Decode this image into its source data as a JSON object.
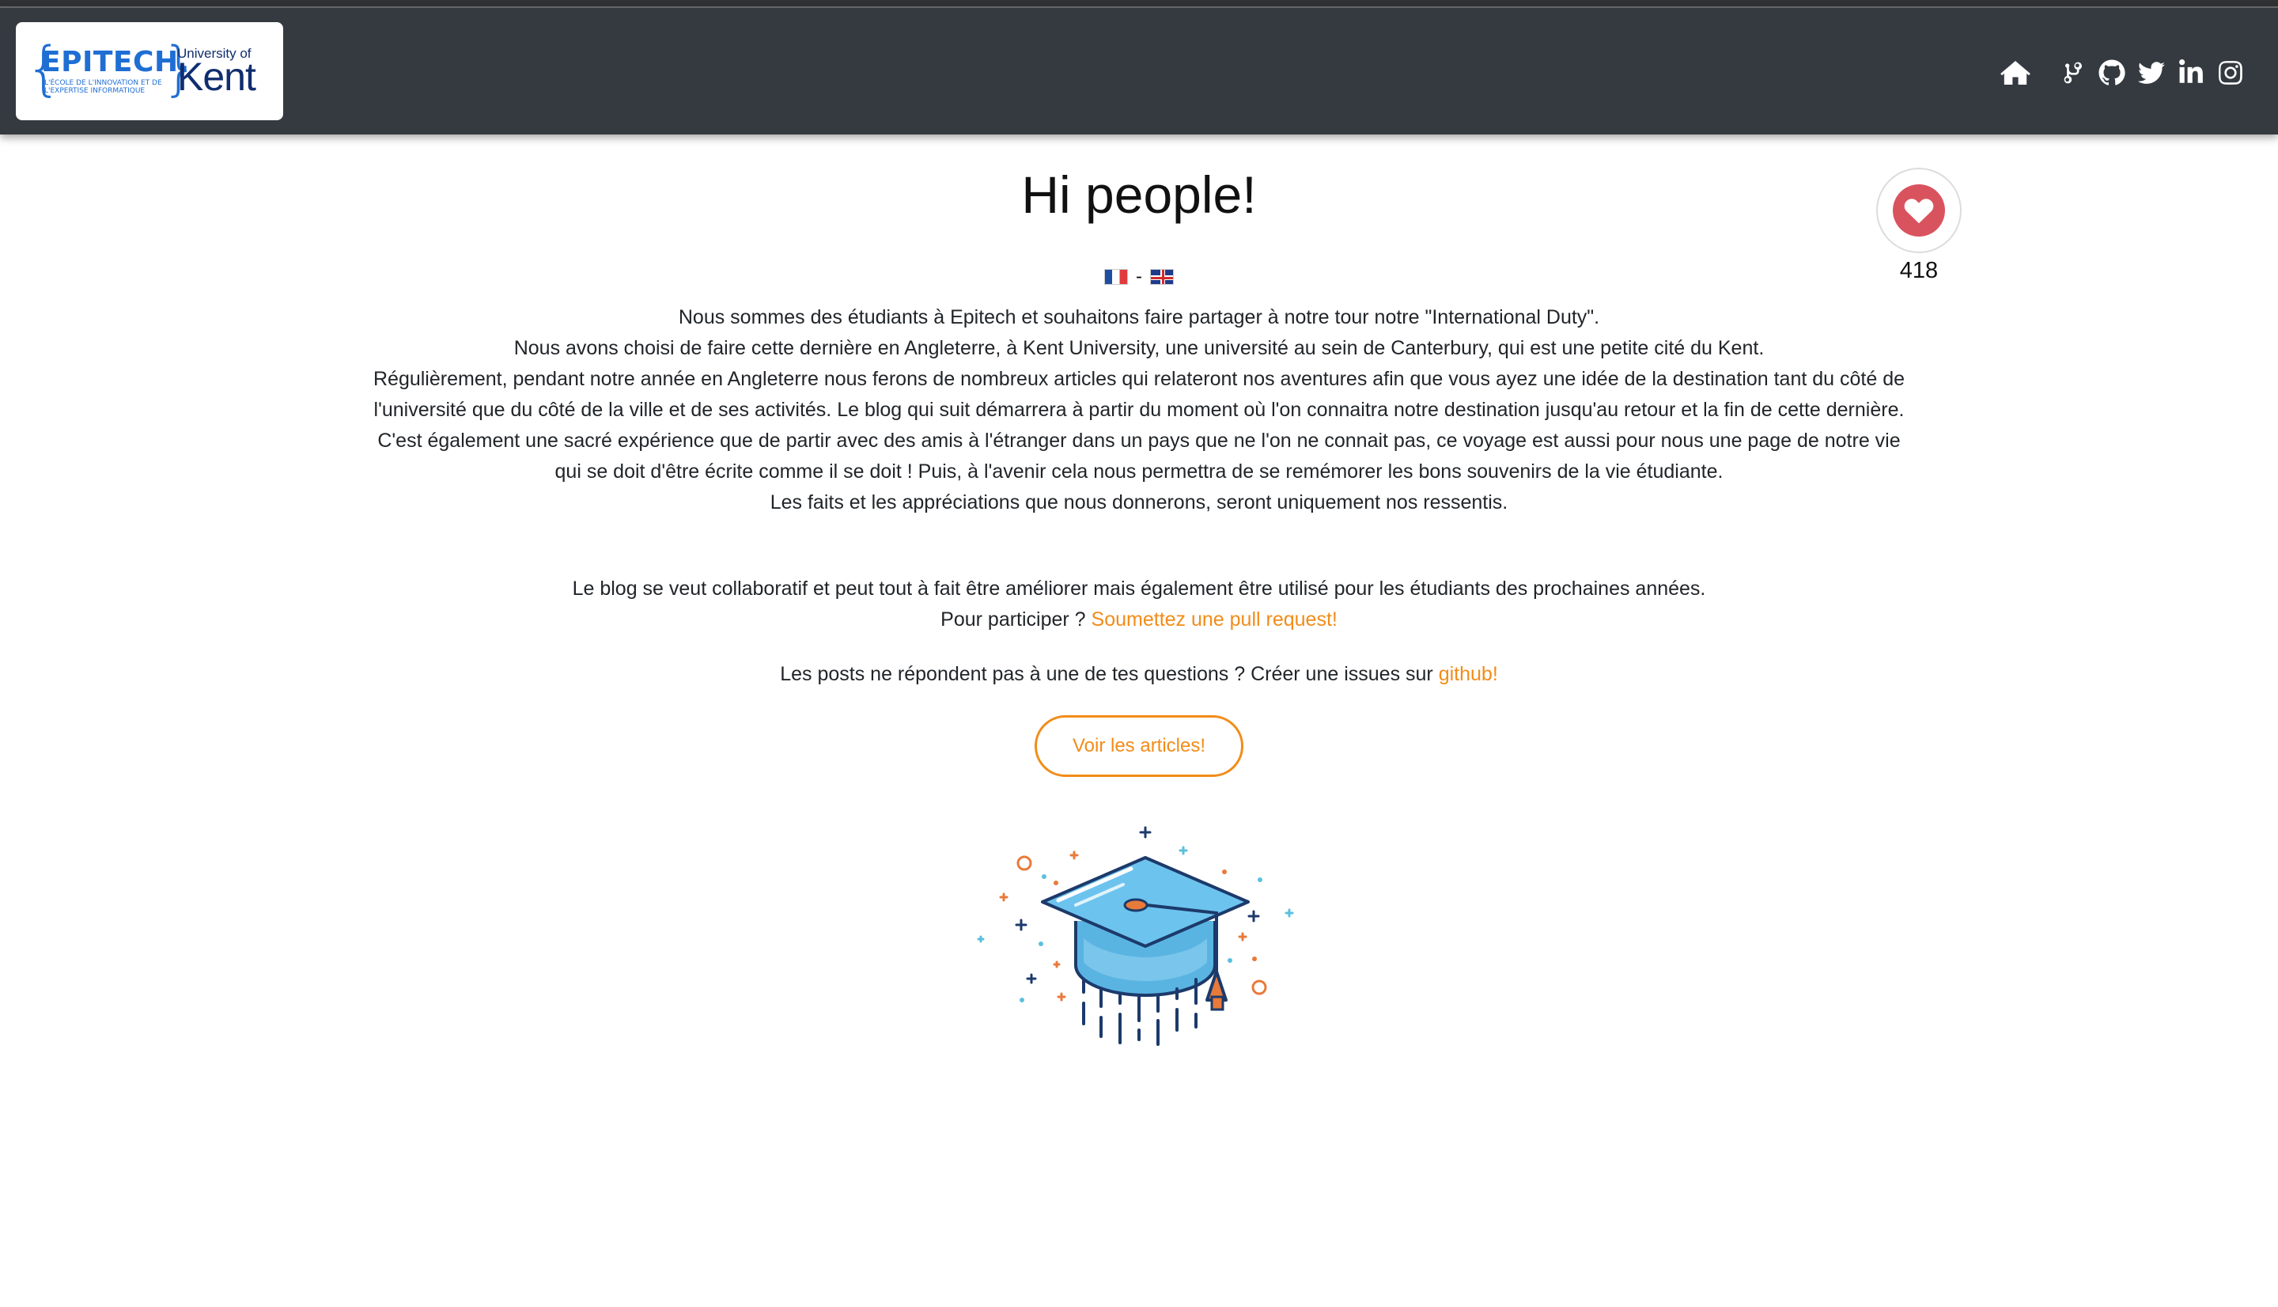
{
  "navbar": {
    "logo": {
      "epitech_word": "EPITECH.",
      "epitech_tagline": "L'ÉCOLE DE L'INNOVATION ET DE L'EXPERTISE INFORMATIQUE",
      "kent_small": "University of",
      "kent_large": "Kent"
    },
    "icons": [
      "home-icon",
      "git-branch-icon",
      "github-icon",
      "twitter-icon",
      "linkedin-icon",
      "instagram-icon"
    ],
    "color": "#343a40"
  },
  "main": {
    "title": "Hi people!",
    "flags_separator": "-",
    "intro": [
      "Nous sommes des étudiants à Epitech et souhaitons faire partager à notre tour notre \"International Duty\".",
      "Nous avons choisi de faire cette dernière en Angleterre, à Kent University, une université au sein de Canterbury, qui est une petite cité du Kent.",
      "Régulièrement, pendant notre année en Angleterre nous ferons de nombreux articles qui relateront nos aventures afin que vous ayez une idée de la destination tant du côté de l'université que du côté de la ville et de ses activités. Le blog qui suit démarrera à partir du moment où l'on connaitra notre destination jusqu'au retour et la fin de cette dernière.",
      "C'est également une sacré expérience que de partir avec des amis à l'étranger dans un pays que ne l'on ne connait pas, ce voyage est aussi pour nous une page de notre vie qui se doit d'être écrite comme il se doit ! Puis, à l'avenir cela nous permettra de se remémorer les bons souvenirs de la vie étudiante.",
      "Les faits et les appréciations que nous donnerons, seront uniquement nos ressentis."
    ],
    "collab_text": "Le blog se veut collaboratif et peut tout à fait être améliorer mais également être utilisé pour les étudiants des prochaines années.",
    "participate_text": "Pour participer ? ",
    "participate_link": "Soumettez une pull request!",
    "issues_text": "Les posts ne répondent pas à une de tes questions ? Créer une issues sur ",
    "issues_link": "github!",
    "button_label": "Voir les articles!",
    "accent_color": "#f28c18"
  },
  "like": {
    "count": "418",
    "color": "#d9535f"
  }
}
